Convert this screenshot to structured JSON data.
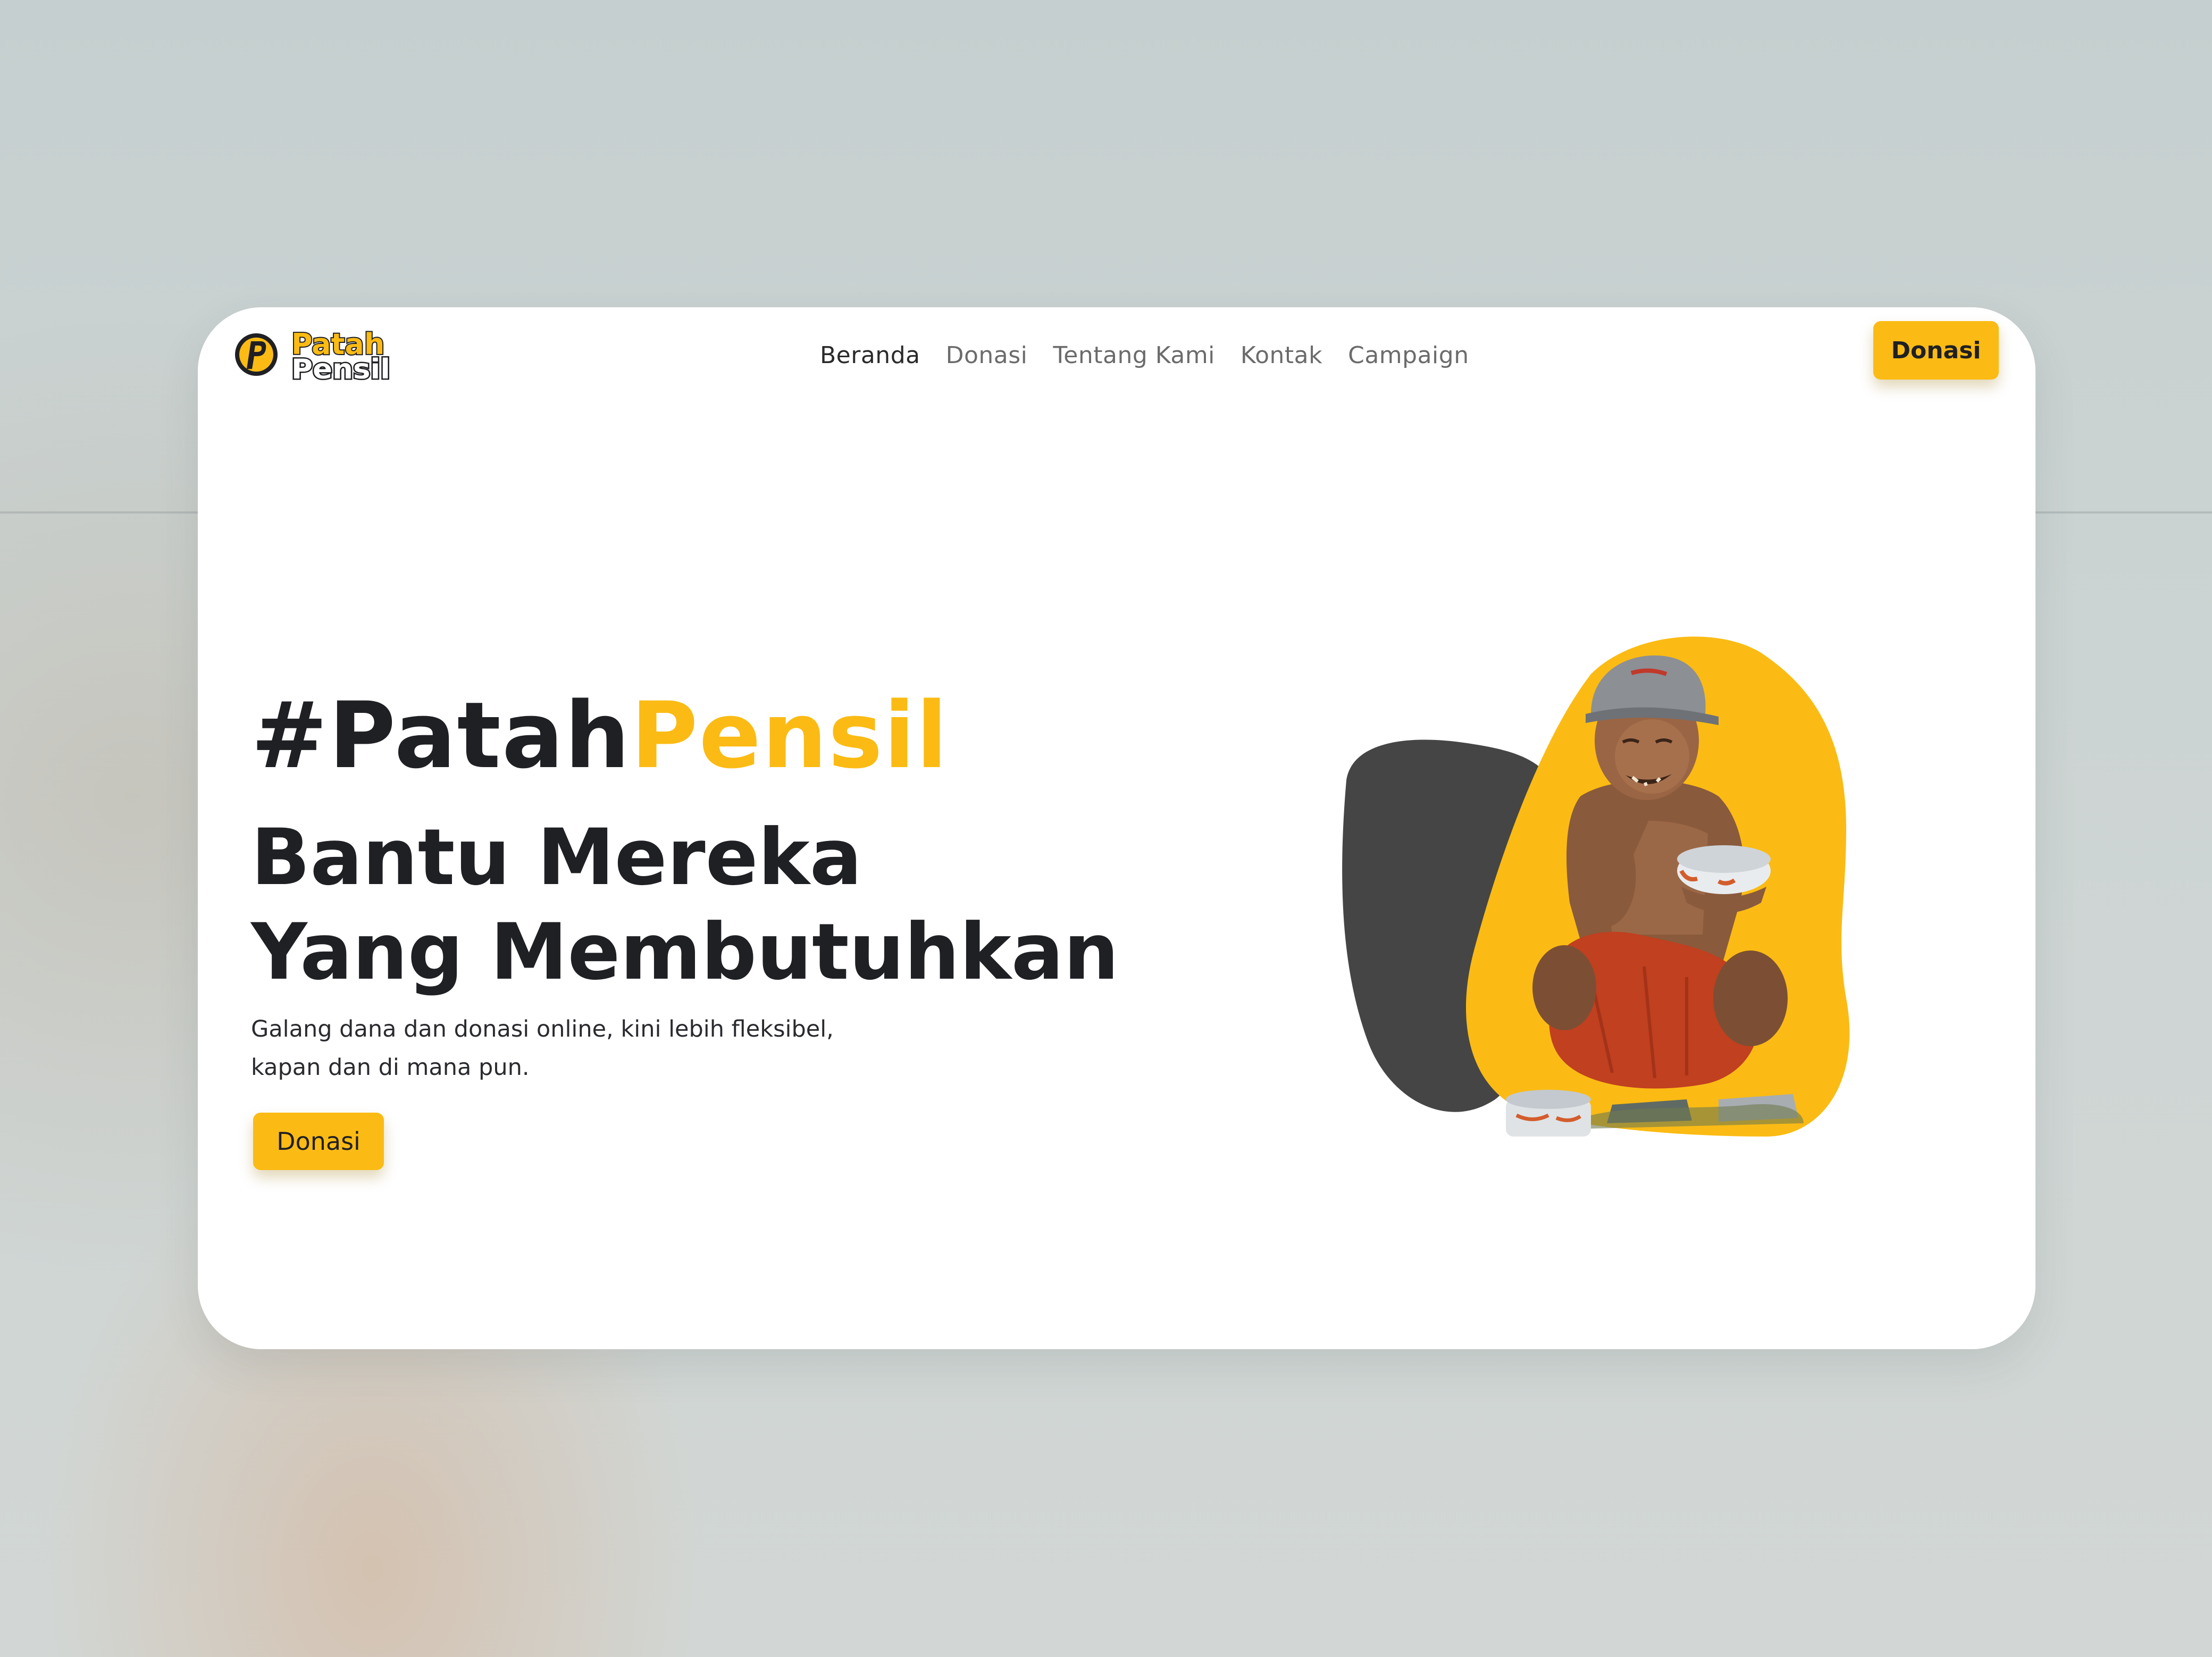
{
  "brand": {
    "logo_text_line1": "Patah",
    "logo_text_line2": "Pensil",
    "logo_mark": "P"
  },
  "nav": {
    "links": [
      {
        "label": "Beranda",
        "active": true
      },
      {
        "label": "Donasi",
        "active": false
      },
      {
        "label": "Tentang Kami",
        "active": false
      },
      {
        "label": "Kontak",
        "active": false
      },
      {
        "label": "Campaign",
        "active": false
      }
    ],
    "cta_label": "Donasi"
  },
  "hero": {
    "hashtag_dark": "#Patah",
    "hashtag_accent": "Pensil",
    "headline_line1": "Bantu Mereka",
    "headline_line2": "Yang Membutuhkan",
    "subtext_line1": "Galang dana dan donasi online, kini lebih fleksibel,",
    "subtext_line2": "kapan dan di mana pun.",
    "cta_label": "Donasi",
    "image_icon": "person-photo-icon"
  },
  "colors": {
    "accent": "#fbbb14",
    "text_dark": "#1f2024",
    "blob_dark": "#454545",
    "card_bg": "#ffffff"
  }
}
